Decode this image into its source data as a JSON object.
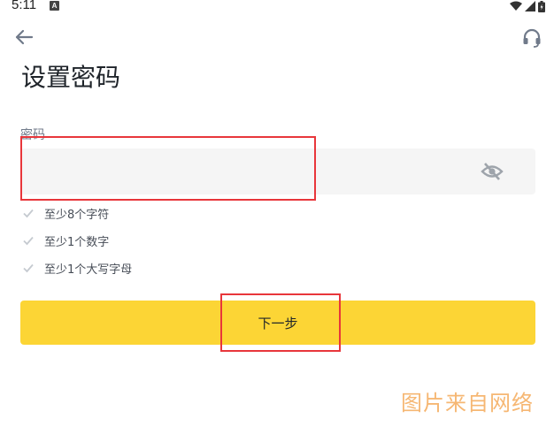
{
  "status_bar": {
    "time": "5:11",
    "notification_badge": "A"
  },
  "page": {
    "title": "设置密码"
  },
  "password_field": {
    "label": "密码",
    "value": "",
    "placeholder": ""
  },
  "rules": [
    {
      "text": "至少8个字符"
    },
    {
      "text": "至少1个数字"
    },
    {
      "text": "至少1个大写字母"
    }
  ],
  "actions": {
    "next_label": "下一步"
  },
  "watermark": "图片来自网络",
  "colors": {
    "accent": "#fcd535",
    "highlight": "#e8363b",
    "watermark": "#f6b773"
  },
  "icons": [
    "back-arrow-icon",
    "headset-icon",
    "eye-off-icon",
    "check-icon"
  ]
}
